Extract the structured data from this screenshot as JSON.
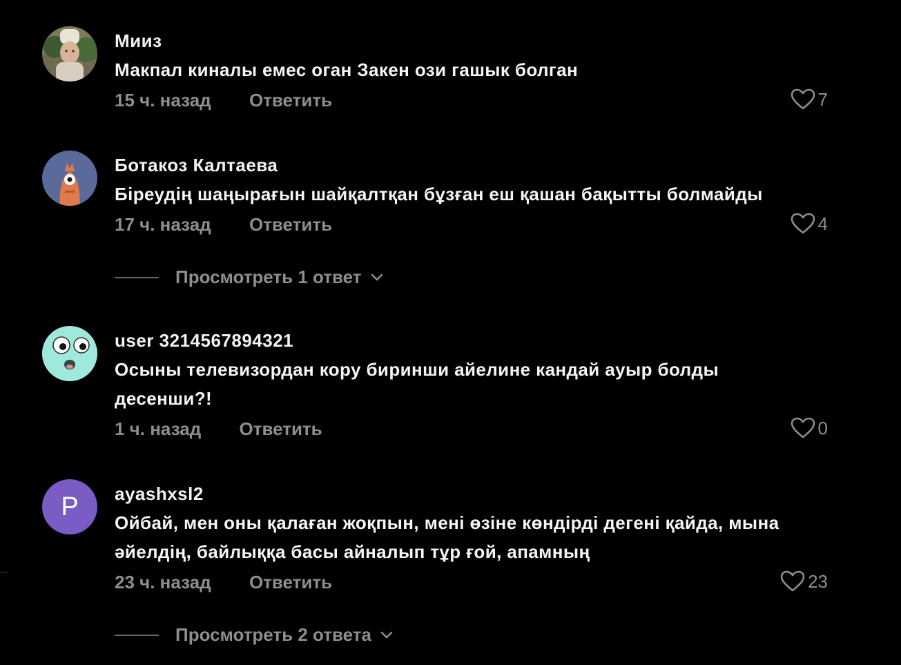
{
  "comments": [
    {
      "username": "Мииз",
      "text": "Макпал киналы емес оган Закен ози гашык болган",
      "time": "15 ч. назад",
      "reply_label": "Ответить",
      "likes": "7",
      "avatar_icon": "photo-avatar"
    },
    {
      "username": "Ботакоз Калтаева",
      "text": "Біреудің шаңырағын шайқалтқан бұзған еш қашан бақытты болмайды",
      "time": "17 ч. назад",
      "reply_label": "Ответить",
      "likes": "4",
      "avatar_icon": "cartoon-avatar",
      "view_replies": "Просмотреть 1 ответ"
    },
    {
      "username": "user 3214567894321",
      "text": "Осыны телевизордан кору биринши айелине кандай ауыр болды десенши?!",
      "time": "1 ч. назад",
      "reply_label": "Ответить",
      "likes": "0",
      "avatar_icon": "googly-eyes-avatar"
    },
    {
      "username": "ayashxsl2",
      "text": "Ойбай, мен оны қалаған жоқпын, мені өзіне көндірді дегені қайда, мына әйелдің, байлыққа басы айналып тұр ғой, апамның",
      "time": "23 ч. назад",
      "reply_label": "Ответить",
      "likes": "23",
      "avatar_icon": "letter-avatar",
      "avatar_letter": "P",
      "view_replies": "Просмотреть 2 ответа"
    }
  ],
  "colors": {
    "background": "#000000",
    "text_primary": "#f5f5f5",
    "text_secondary": "#8e8e8e",
    "avatar_letter_bg": "#7b5cc4"
  }
}
